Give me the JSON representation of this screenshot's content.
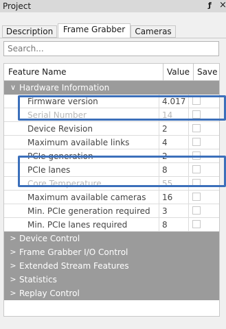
{
  "window": {
    "title": "Project",
    "pin_glyph": "ƒ",
    "close_glyph": "×"
  },
  "tabs": [
    {
      "label": "Description",
      "active": false
    },
    {
      "label": "Frame Grabber",
      "active": true
    },
    {
      "label": "Cameras",
      "active": false
    }
  ],
  "search": {
    "placeholder": "Search..."
  },
  "table": {
    "columns": [
      "Feature Name",
      "Value",
      "Save"
    ],
    "groups": [
      {
        "label": "Hardware Information",
        "expanded": true,
        "arrow": "∨",
        "rows": [
          {
            "name": "Firmware version",
            "value": "4.017",
            "faded": false
          },
          {
            "name": "Serial Number",
            "value": "14",
            "faded": true
          },
          {
            "name": "Device Revision",
            "value": "2",
            "faded": false
          },
          {
            "name": "Maximum available links",
            "value": "4",
            "faded": false
          },
          {
            "name": "PCIe generation",
            "value": "2",
            "faded": false
          },
          {
            "name": "PCIe lanes",
            "value": "8",
            "faded": false
          },
          {
            "name": "Core Temperature",
            "value": "55",
            "faded": true
          },
          {
            "name": "Maximum available cameras",
            "value": "16",
            "faded": false
          },
          {
            "name": "Min. PCIe generation required",
            "value": "3",
            "faded": false
          },
          {
            "name": "Min. PCIe lanes required",
            "value": "8",
            "faded": false
          }
        ]
      },
      {
        "label": "Device Control",
        "expanded": false,
        "arrow": ">"
      },
      {
        "label": "Frame Grabber I/O Control",
        "expanded": false,
        "arrow": ">"
      },
      {
        "label": "Extended Stream Features",
        "expanded": false,
        "arrow": ">"
      },
      {
        "label": "Statistics",
        "expanded": false,
        "arrow": ">"
      },
      {
        "label": "Replay Control",
        "expanded": false,
        "arrow": ">"
      }
    ]
  },
  "highlight_color": "#3b6fba"
}
